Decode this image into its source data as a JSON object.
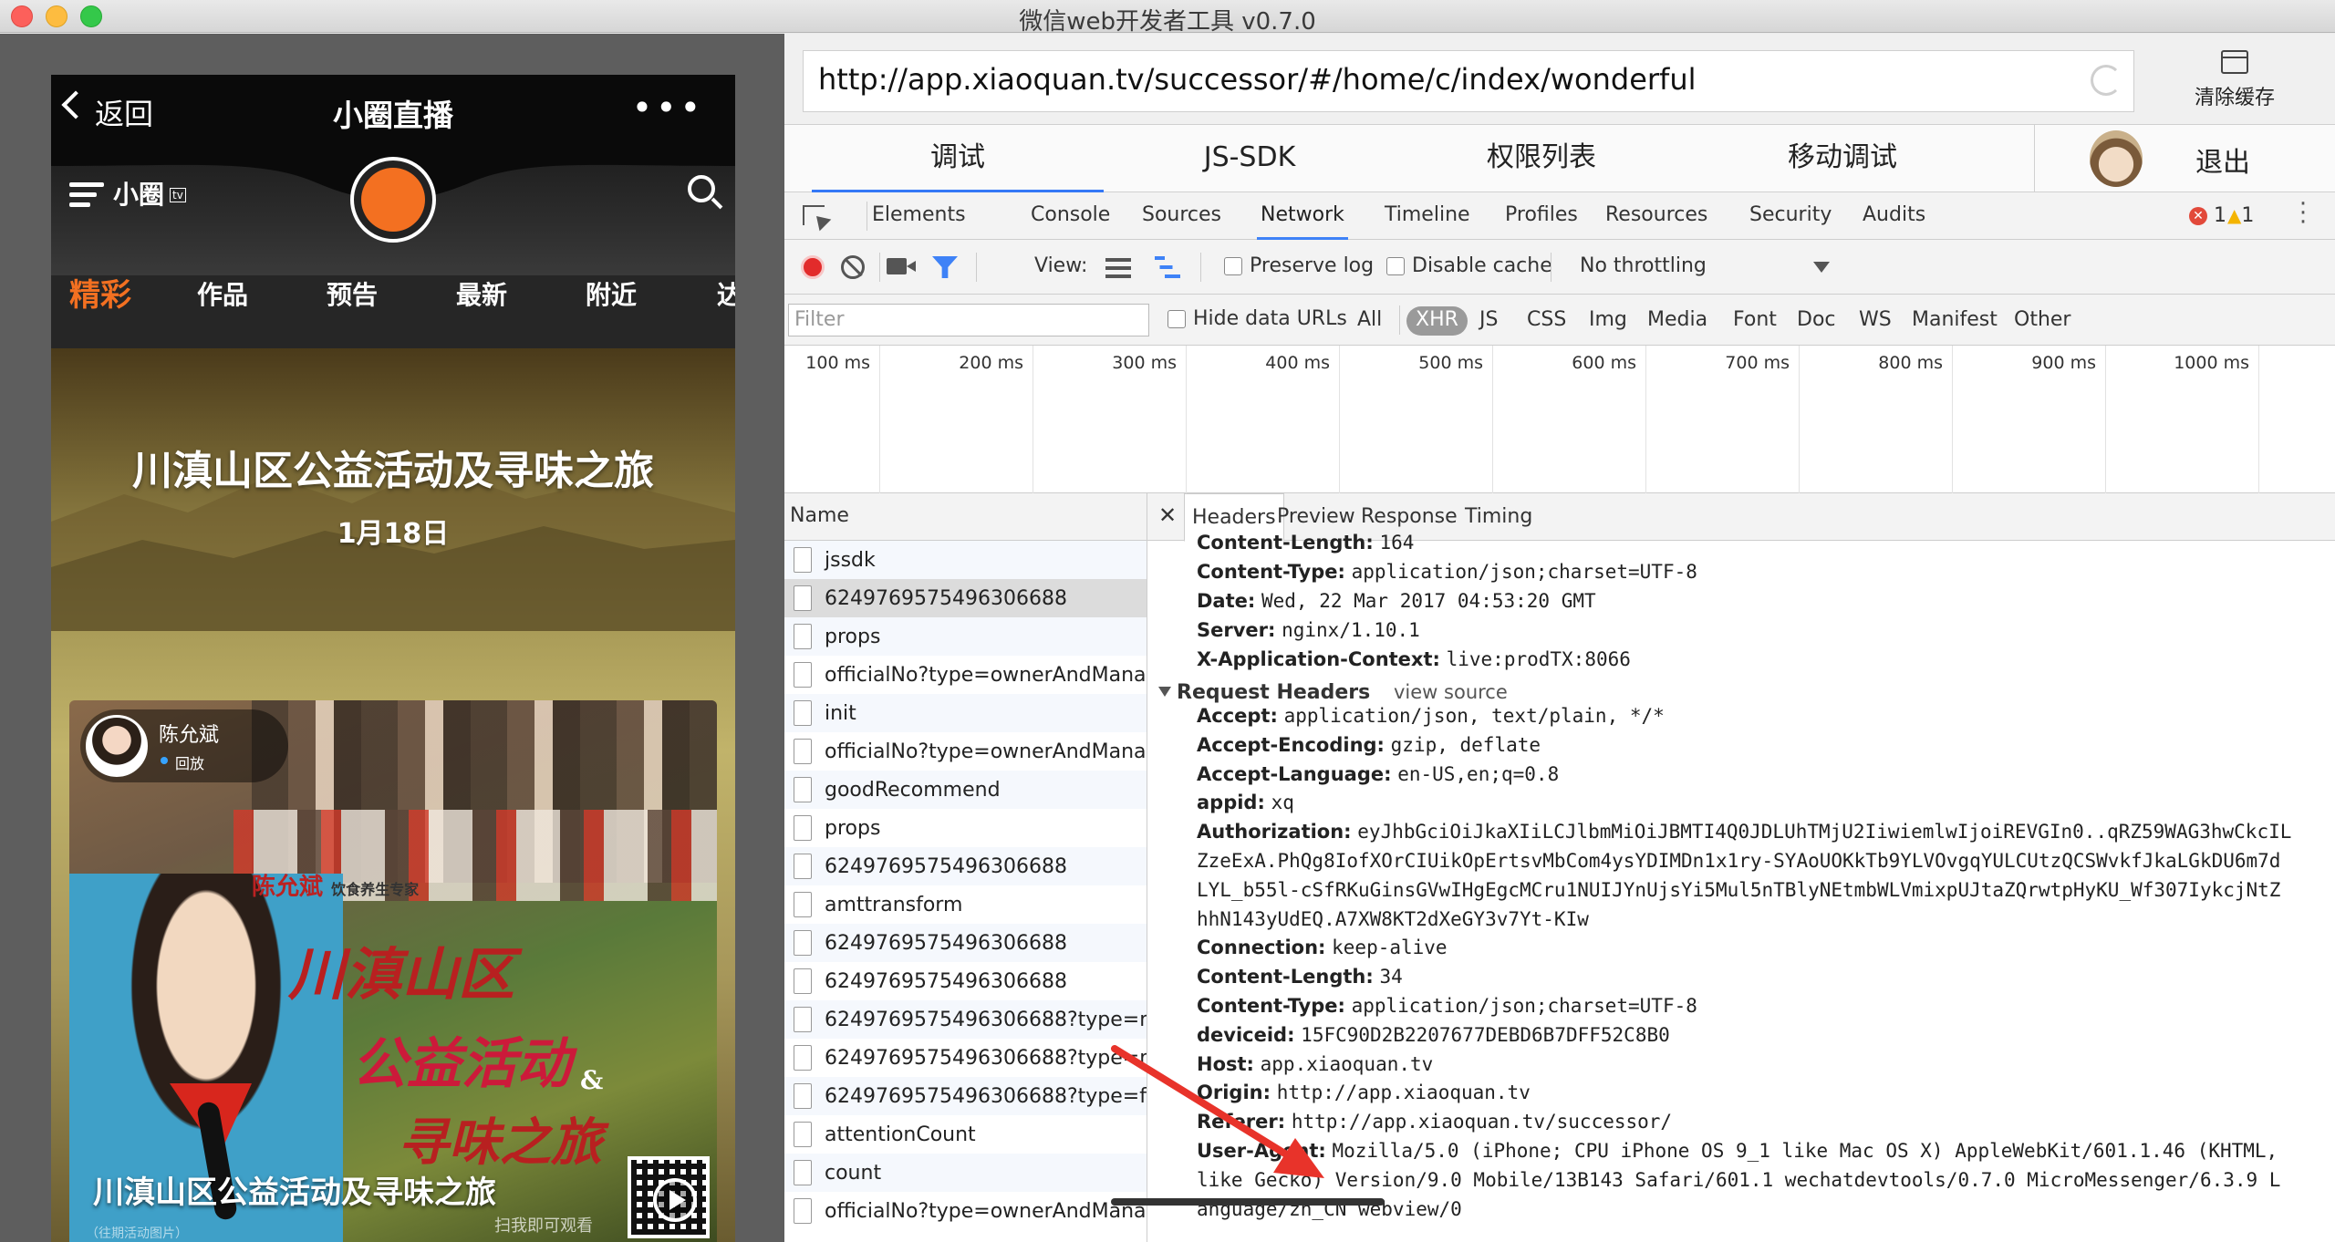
{
  "window": {
    "title": "微信web开发者工具 v0.7.0"
  },
  "phone": {
    "nav": {
      "back_label": "返回",
      "title": "小圈直播",
      "more": "•••"
    },
    "logo": {
      "text": "小圈",
      "badge": "tv"
    },
    "categories": [
      "精彩",
      "作品",
      "预告",
      "最新",
      "附近",
      "达"
    ],
    "banner": {
      "title": "川滇山区公益活动及寻味之旅",
      "date": "1月18日"
    },
    "card": {
      "streamer_name": "陈允斌",
      "streamer_status": "回放",
      "sub_heading": "陈允斌",
      "sub_heading_note": "饮食养生专家",
      "poster_lines": [
        "川滇山区",
        "公益活动",
        "&",
        "寻味之旅"
      ],
      "title": "川滇山区公益活动及寻味之旅",
      "caption": "（往期活动图片）",
      "scan_text": "扫我即可观看"
    }
  },
  "devtools": {
    "url": "http://app.xiaoquan.tv/successor/#/home/c/index/wonderful",
    "clear_cache_label": "清除缓存",
    "main_tabs": [
      "调试",
      "JS-SDK",
      "权限列表",
      "移动调试"
    ],
    "logout_label": "退出",
    "panel_tabs": [
      "Elements",
      "Console",
      "Sources",
      "Network",
      "Timeline",
      "Profiles",
      "Resources",
      "Security",
      "Audits"
    ],
    "active_panel": "Network",
    "error_count": "1",
    "warning_count": "1",
    "toolbar": {
      "view_label": "View:",
      "preserve_log": "Preserve log",
      "disable_cache": "Disable cache",
      "throttling": "No throttling"
    },
    "filter": {
      "placeholder": "Filter",
      "hide_data_urls": "Hide data URLs",
      "types": [
        "All",
        "XHR",
        "JS",
        "CSS",
        "Img",
        "Media",
        "Font",
        "Doc",
        "WS",
        "Manifest",
        "Other"
      ],
      "active_type": "XHR"
    },
    "timeline_ticks": [
      "100 ms",
      "200 ms",
      "300 ms",
      "400 ms",
      "500 ms",
      "600 ms",
      "700 ms",
      "800 ms",
      "900 ms",
      "1000 ms"
    ],
    "requests": {
      "header": "Name",
      "items": [
        "jssdk",
        "6249769575496306688",
        "props",
        "officialNo?type=ownerAndManage...",
        "init",
        "officialNo?type=ownerAndManage...",
        "goodRecommend",
        "props",
        "6249769575496306688",
        "amttransform",
        "6249769575496306688",
        "6249769575496306688",
        "6249769575496306688?type=m...",
        "6249769575496306688?type=m...",
        "6249769575496306688?type=fa...",
        "attentionCount",
        "count",
        "officialNo?type=ownerAndManage..."
      ],
      "selected_index": 1
    },
    "detail_tabs": [
      "Headers",
      "Preview",
      "Response",
      "Timing"
    ],
    "response_headers": [
      {
        "k": "Content-Length:",
        "v": "164"
      },
      {
        "k": "Content-Type:",
        "v": "application/json;charset=UTF-8"
      },
      {
        "k": "Date:",
        "v": "Wed, 22 Mar 2017 04:53:20 GMT"
      },
      {
        "k": "Server:",
        "v": "nginx/1.10.1"
      },
      {
        "k": "X-Application-Context:",
        "v": "live:prodTX:8066"
      }
    ],
    "request_headers_title": "Request Headers",
    "view_source": "view source",
    "request_headers": [
      {
        "k": "Accept:",
        "v": "application/json, text/plain, */*"
      },
      {
        "k": "Accept-Encoding:",
        "v": "gzip, deflate"
      },
      {
        "k": "Accept-Language:",
        "v": "en-US,en;q=0.8"
      },
      {
        "k": "appid:",
        "v": "xq"
      },
      {
        "k": "Authorization:",
        "v": "eyJhbGciOiJkaXIiLCJlbmMiOiJBMTI4Q0JDLUhTMjU2IiwiemlwIjoiREVGIn0..qRZ59WAG3hwCkcIL"
      },
      {
        "k": "",
        "v": "ZzeExA.PhQg8IofXOrCIUikOpErtsvMbCom4ysYDIMDn1x1ry-SYAoUOKkTb9YLVOvgqYULCUtzQCSWvkfJkaLGkDU6m7d"
      },
      {
        "k": "",
        "v": "LYL_b55l-cSfRKuGinsGVwIHgEgcMCru1NUIJYnUjsYi5Mul5nTBlyNEtmbWLVmixpUJtaZQrwtpHyKU_Wf307IykcjNtZ"
      },
      {
        "k": "",
        "v": "hhN143yUdEQ.A7XW8KT2dXeGY3v7Yt-KIw"
      },
      {
        "k": "Connection:",
        "v": "keep-alive"
      },
      {
        "k": "Content-Length:",
        "v": "34"
      },
      {
        "k": "Content-Type:",
        "v": "application/json;charset=UTF-8"
      },
      {
        "k": "deviceid:",
        "v": "15FC90D2B2207677DEBD6B7DFF52C8B0"
      },
      {
        "k": "Host:",
        "v": "app.xiaoquan.tv"
      },
      {
        "k": "Origin:",
        "v": "http://app.xiaoquan.tv"
      },
      {
        "k": "Referer:",
        "v": "http://app.xiaoquan.tv/successor/"
      },
      {
        "k": "User-Agent:",
        "v": "Mozilla/5.0 (iPhone; CPU iPhone OS 9_1 like Mac OS X) AppleWebKit/601.1.46 (KHTML,"
      },
      {
        "k": "",
        "v": "like Gecko) Version/9.0 Mobile/13B143 Safari/601.1 wechatdevtools/0.7.0 MicroMessenger/6.3.9 L"
      },
      {
        "k": "",
        "v": "anguage/zh_CN webview/0"
      }
    ]
  },
  "colors": {
    "accent_orange": "#f37021",
    "devtools_blue": "#3e82f7",
    "annotation_arrow": "#e8332a"
  }
}
